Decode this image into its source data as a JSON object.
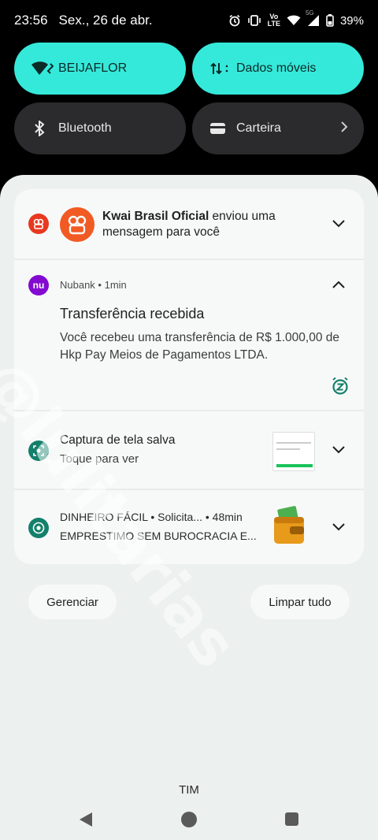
{
  "status_bar": {
    "time": "23:56",
    "date": "Sex., 26 de abr.",
    "net_label_top": "Vo",
    "net_label_bottom": "LTE",
    "net_5g": "5G",
    "battery": "39%"
  },
  "tiles": [
    {
      "label": "BEIJAFLOR",
      "icon": "wifi-icon",
      "state": "on"
    },
    {
      "label": "Dados móveis",
      "icon": "mobile-data-icon",
      "state": "on"
    },
    {
      "label": "Bluetooth",
      "icon": "bluetooth-icon",
      "state": "off"
    },
    {
      "label": "Carteira",
      "icon": "wallet-icon",
      "state": "off"
    }
  ],
  "notifications": {
    "kwai": {
      "sender": "Kwai Brasil Oficial",
      "message": " enviou uma mensagem para você"
    },
    "nubank": {
      "app_badge": "nu",
      "meta": "Nubank • 1min",
      "title": "Transferência recebida",
      "body": "Você recebeu uma transferência de R$ 1.000,00 de Hkp Pay Meios de Pagamentos LTDA."
    },
    "screenshot": {
      "line1": "Captura de tela salva",
      "line2": "Toque para ver"
    },
    "chrome": {
      "line1": "DINHEIRO FÁCIL • Solicita... • 48min",
      "line2": "EMPRESTIMO SEM BUROCRACIA E..."
    }
  },
  "actions": {
    "manage": "Gerenciar",
    "clear_all": "Limpar tudo"
  },
  "watermark": "@lulitarias",
  "carrier": "TIM",
  "colors": {
    "tile_active": "#35e9da",
    "tile_inactive": "#2b2b2d",
    "nubank_purple": "#820ad1",
    "kwai_orange": "#f25a23",
    "snooze_green": "#14806b"
  }
}
